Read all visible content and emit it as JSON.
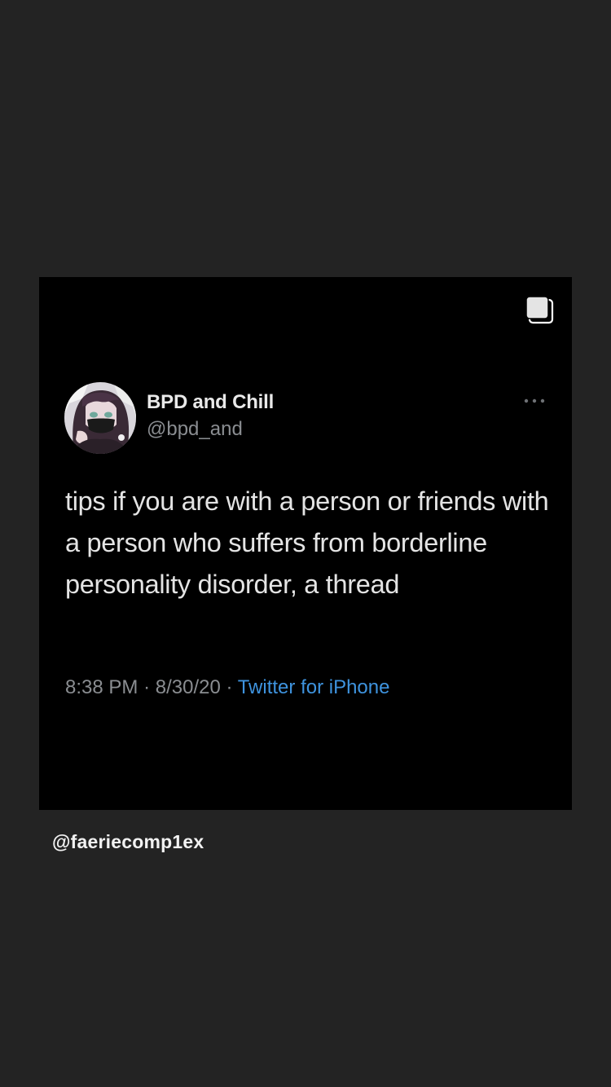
{
  "post": {
    "author": {
      "display_name": "BPD and Chill",
      "handle": "@bpd_and",
      "avatar_icon": "anime-character-avatar"
    },
    "text": "tips if you are with a person or friends with a person who suffers from borderline personality disorder, a thread",
    "meta": {
      "time": "8:38 PM",
      "separator": "·",
      "date": "8/30/20",
      "source": "Twitter for iPhone"
    },
    "icons": {
      "multi_select": "multiple-photos-icon",
      "more": "more-options-icon"
    }
  },
  "footer": {
    "username": "@faeriecomp1ex"
  },
  "colors": {
    "background": "#232323",
    "card": "#000000",
    "text_primary": "#e4e4e4",
    "text_secondary": "#8a8d91",
    "link": "#3e93de"
  }
}
